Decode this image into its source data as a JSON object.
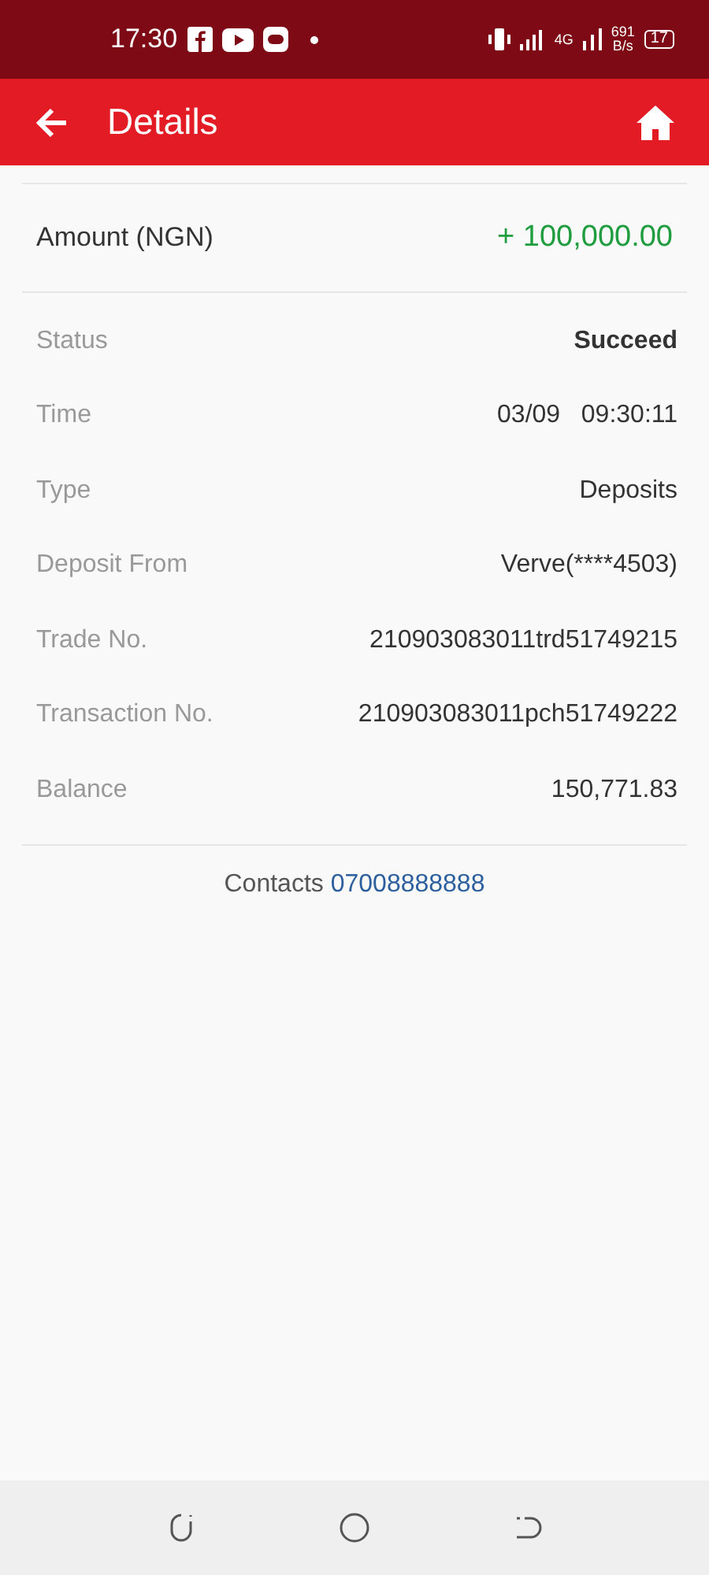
{
  "status_bar": {
    "time": "17:30",
    "network": "4G",
    "speed": "691",
    "speed_unit": "B/s",
    "battery": "17"
  },
  "header": {
    "title": "Details"
  },
  "amount": {
    "label": "Amount (NGN)",
    "value": "+ 100,000.00"
  },
  "rows": [
    {
      "label": "Status",
      "value": "Succeed",
      "kind": "strong"
    },
    {
      "label": "Time",
      "value": "03/09   09:30:11",
      "kind": "plain"
    },
    {
      "label": "Type",
      "value": "Deposits",
      "kind": "plain"
    },
    {
      "label": "Deposit From",
      "value": "Verve(****4503)",
      "kind": "plain"
    },
    {
      "label": "Trade No.",
      "value": "210903083011trd51749215",
      "kind": "plain"
    },
    {
      "label": "Transaction No.",
      "value": "210903083011pch51749222",
      "kind": "plain"
    },
    {
      "label": "Balance",
      "value": "150,771.83",
      "kind": "plain"
    }
  ],
  "contacts": {
    "label": "Contacts",
    "phone": "07008888888"
  }
}
